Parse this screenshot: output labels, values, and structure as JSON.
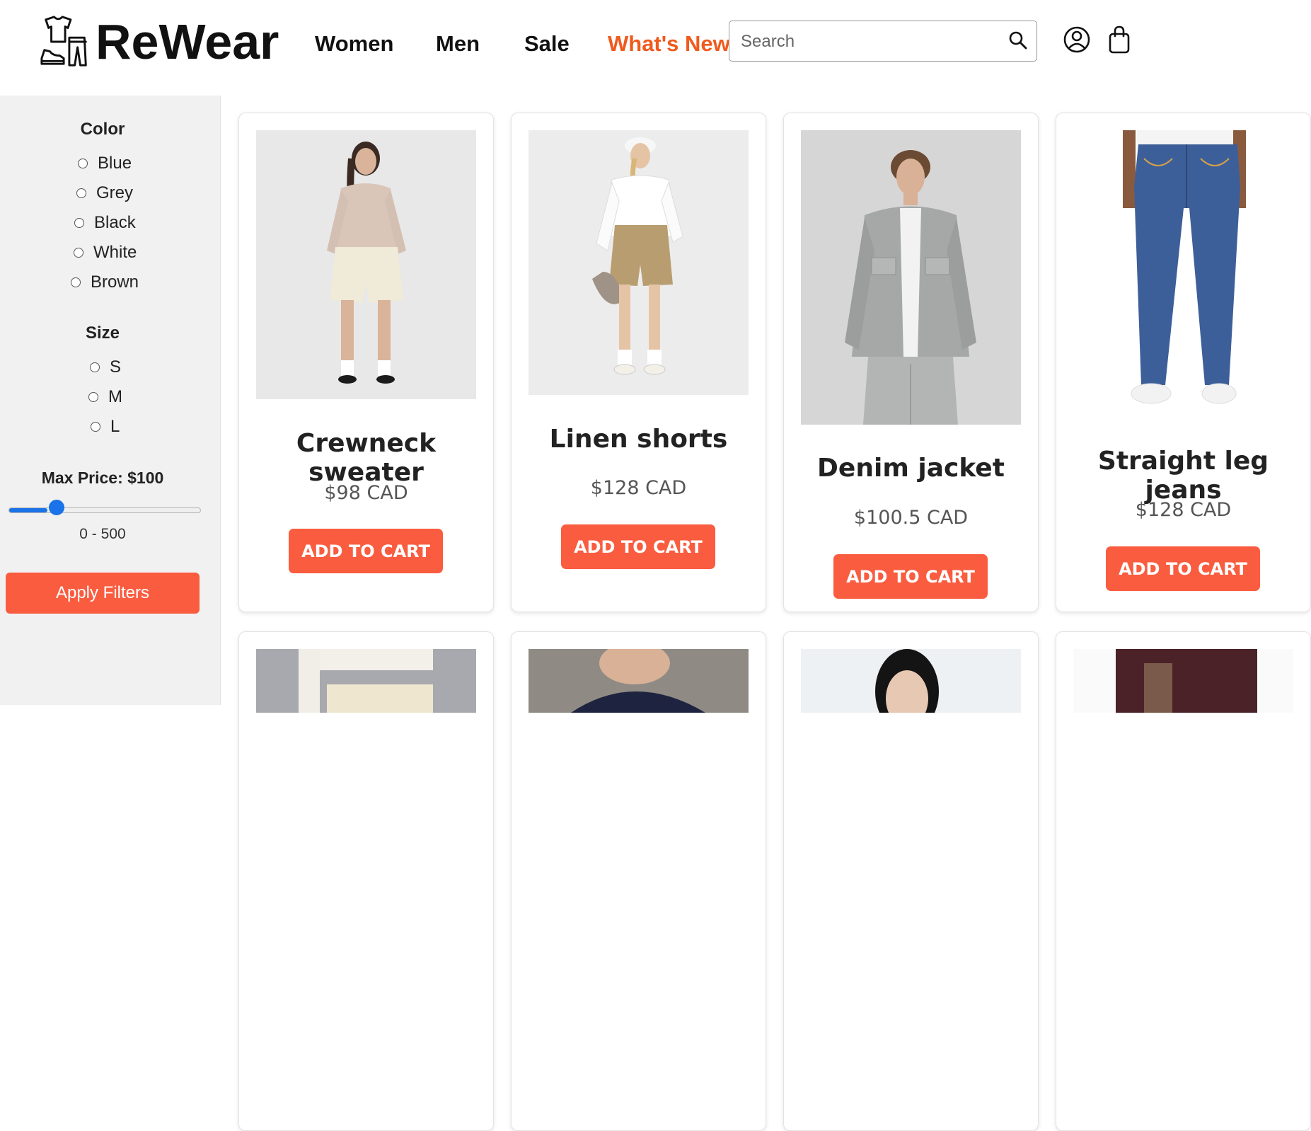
{
  "brand": {
    "name": "ReWear"
  },
  "nav": {
    "items": [
      {
        "label": "Women"
      },
      {
        "label": "Men"
      },
      {
        "label": "Sale"
      },
      {
        "label": "What's New",
        "accent": true
      }
    ]
  },
  "search": {
    "placeholder": "Search",
    "value": ""
  },
  "filters": {
    "color": {
      "heading": "Color",
      "options": [
        "Blue",
        "Grey",
        "Black",
        "White",
        "Brown"
      ]
    },
    "size": {
      "heading": "Size",
      "options": [
        "S",
        "M",
        "L"
      ]
    },
    "price": {
      "label": "Max Price: $100",
      "value": 100,
      "min": 0,
      "max": 500,
      "range_text": "0 - 500"
    },
    "apply_label": "Apply Filters"
  },
  "products": [
    {
      "title": "Crewneck sweater",
      "price": "$98 CAD",
      "button": "ADD TO CART",
      "image": "woman-sweater-shorts-photo"
    },
    {
      "title": "Linen shorts",
      "price": "$128 CAD",
      "button": "ADD TO CART",
      "image": "woman-linen-shorts-photo"
    },
    {
      "title": "Denim jacket",
      "price": "$100.5 CAD",
      "button": "ADD TO CART",
      "image": "man-denim-jacket-photo"
    },
    {
      "title": "Straight leg jeans",
      "price": "$128 CAD",
      "button": "ADD TO CART",
      "image": "straight-jeans-photo"
    }
  ],
  "colors": {
    "accent": "#fa5c3f",
    "nav_accent": "#f05a1d",
    "sidebar_bg": "#f1f1f1",
    "slider": "#1a73e8"
  }
}
